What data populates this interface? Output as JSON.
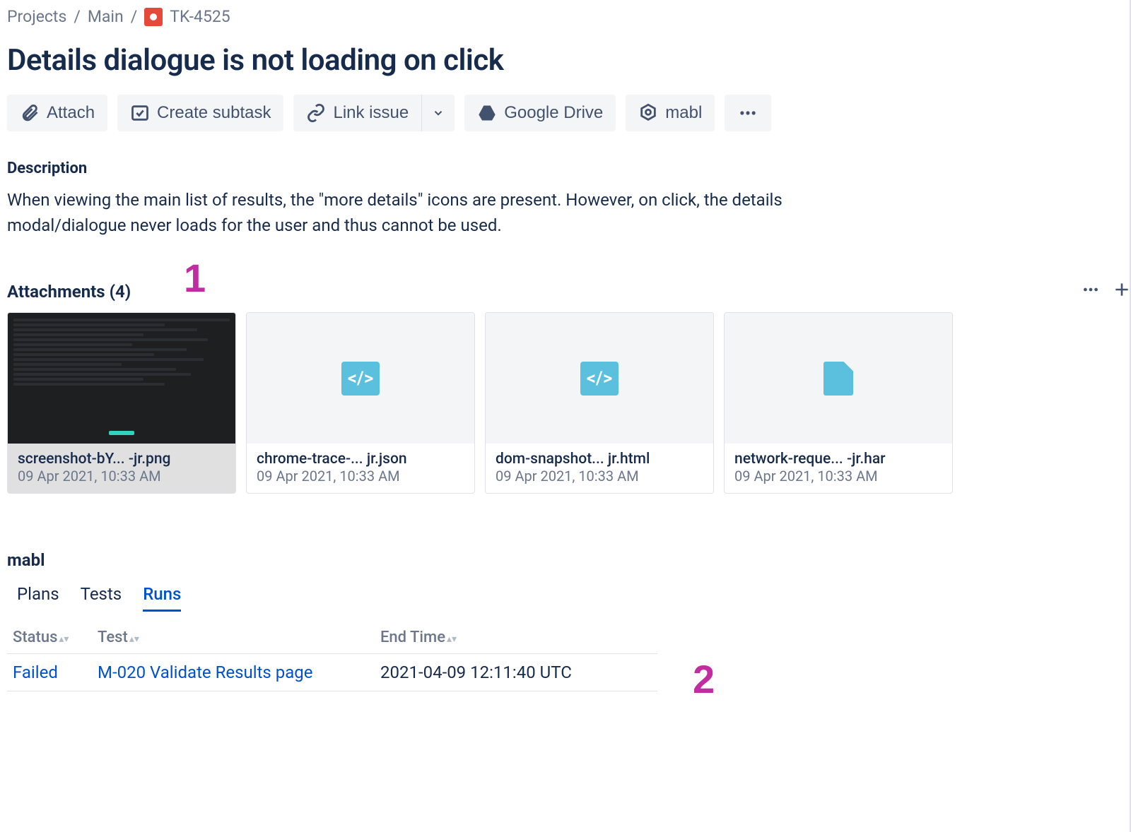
{
  "breadcrumb": {
    "projects": "Projects",
    "main": "Main",
    "issue_key": "TK-4525"
  },
  "issue": {
    "title": "Details dialogue is not loading on click"
  },
  "actions": {
    "attach": "Attach",
    "create_subtask": "Create subtask",
    "link_issue": "Link issue",
    "google_drive": "Google Drive",
    "mabl": "mabl"
  },
  "description": {
    "heading": "Description",
    "body": "When viewing the main list of results, the \"more details\" icons are present. However, on click, the details modal/dialogue never loads for the user and thus cannot be used."
  },
  "attachments": {
    "heading": "Attachments (4)",
    "items": [
      {
        "name": "screenshot-bY... -jr.png",
        "date": "09 Apr 2021, 10:33 AM",
        "type": "image"
      },
      {
        "name": "chrome-trace-... jr.json",
        "date": "09 Apr 2021, 10:33 AM",
        "type": "code"
      },
      {
        "name": "dom-snapshot... jr.html",
        "date": "09 Apr 2021, 10:33 AM",
        "type": "code"
      },
      {
        "name": "network-reque... -jr.har",
        "date": "09 Apr 2021, 10:33 AM",
        "type": "file"
      }
    ]
  },
  "annotations": {
    "one": "1",
    "two": "2"
  },
  "mabl": {
    "heading": "mabl",
    "tabs": {
      "plans": "Plans",
      "tests": "Tests",
      "runs": "Runs"
    },
    "columns": {
      "status": "Status",
      "test": "Test",
      "end_time": "End Time"
    },
    "row": {
      "status": "Failed",
      "test": "M-020 Validate Results page",
      "end_time": "2021-04-09 12:11:40 UTC"
    }
  }
}
